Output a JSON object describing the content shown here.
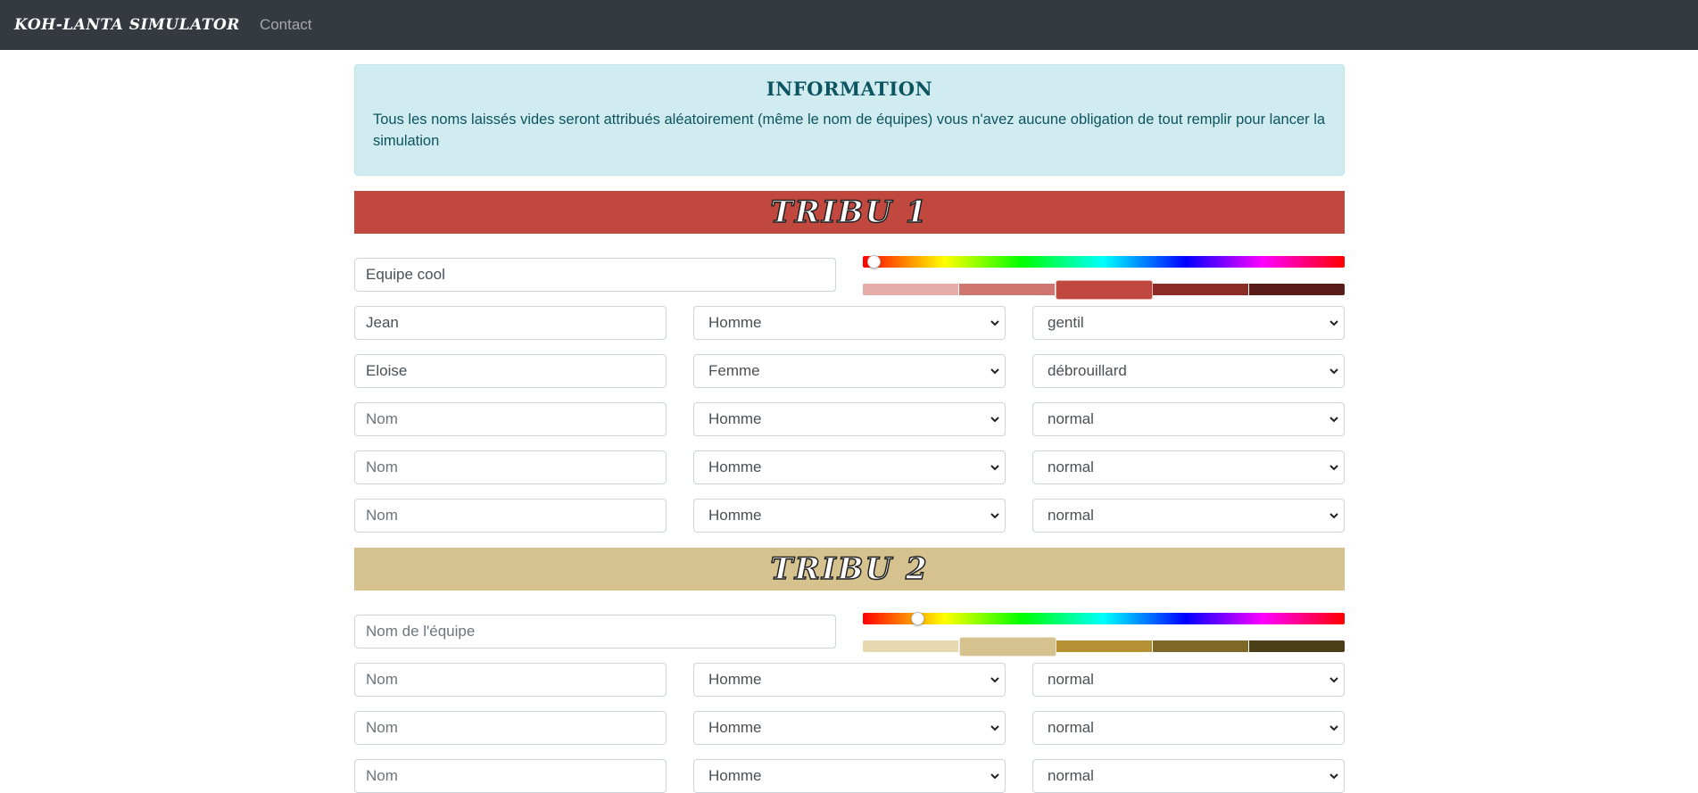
{
  "nav": {
    "brand": "Koh-Lanta Simulator",
    "contact": "Contact"
  },
  "info": {
    "title": "Information",
    "text": "Tous les noms laissés vides seront attribués aléatoirement (même le nom de équipes) vous n'avez aucune obligation de tout remplir pour lancer la simulation"
  },
  "tribes": [
    {
      "title": "Tribu 1",
      "color": "#c1483f",
      "team_name_value": "Equipe cool",
      "team_name_placeholder": "Nom de l'équipe",
      "hue_fraction": 0.01,
      "shades": [
        "#e6aca8",
        "#cf7670",
        "#c1483f",
        "#8c2c26",
        "#5a1c18"
      ],
      "selected_shade": 2,
      "members": [
        {
          "name": "Jean",
          "placeholder": "Nom",
          "gender": "Homme",
          "trait": "gentil"
        },
        {
          "name": "Eloise",
          "placeholder": "Nom",
          "gender": "Femme",
          "trait": "débrouillard"
        },
        {
          "name": "",
          "placeholder": "Nom",
          "gender": "Homme",
          "trait": "normal"
        },
        {
          "name": "",
          "placeholder": "Nom",
          "gender": "Homme",
          "trait": "normal"
        },
        {
          "name": "",
          "placeholder": "Nom",
          "gender": "Homme",
          "trait": "normal"
        }
      ]
    },
    {
      "title": "Tribu 2",
      "color": "#d6c28e",
      "team_name_value": "",
      "team_name_placeholder": "Nom de l'équipe",
      "hue_fraction": 0.1,
      "shades": [
        "#e7d8b0",
        "#d6c28e",
        "#b59133",
        "#7d6827",
        "#4b3f17"
      ],
      "selected_shade": 1,
      "members": [
        {
          "name": "",
          "placeholder": "Nom",
          "gender": "Homme",
          "trait": "normal"
        },
        {
          "name": "",
          "placeholder": "Nom",
          "gender": "Homme",
          "trait": "normal"
        },
        {
          "name": "",
          "placeholder": "Nom",
          "gender": "Homme",
          "trait": "normal"
        }
      ]
    }
  ]
}
